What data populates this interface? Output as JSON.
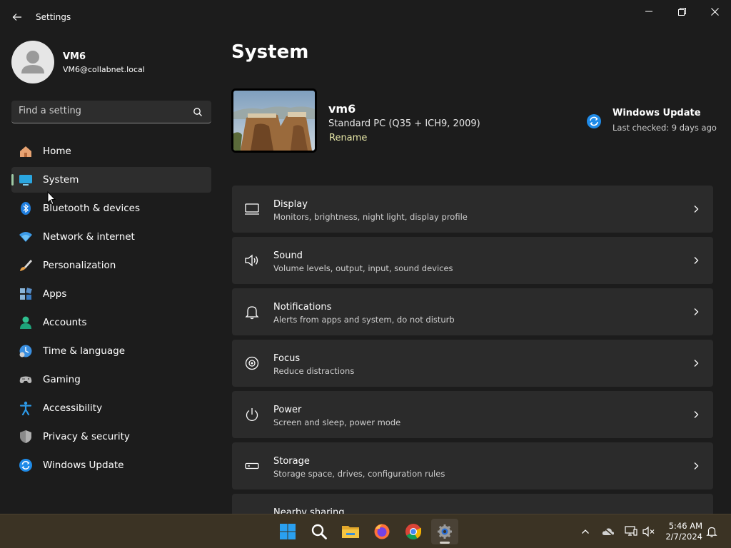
{
  "window": {
    "title": "Settings"
  },
  "profile": {
    "name": "VM6",
    "email": "VM6@collabnet.local"
  },
  "search": {
    "placeholder": "Find a setting"
  },
  "nav": {
    "items": [
      {
        "label": "Home",
        "icon": "home-icon"
      },
      {
        "label": "System",
        "icon": "system-icon",
        "active": true
      },
      {
        "label": "Bluetooth & devices",
        "icon": "bluetooth-icon"
      },
      {
        "label": "Network & internet",
        "icon": "wifi-icon"
      },
      {
        "label": "Personalization",
        "icon": "brush-icon"
      },
      {
        "label": "Apps",
        "icon": "apps-icon"
      },
      {
        "label": "Accounts",
        "icon": "accounts-icon"
      },
      {
        "label": "Time & language",
        "icon": "time-language-icon"
      },
      {
        "label": "Gaming",
        "icon": "gamepad-icon"
      },
      {
        "label": "Accessibility",
        "icon": "accessibility-icon"
      },
      {
        "label": "Privacy & security",
        "icon": "shield-icon"
      },
      {
        "label": "Windows Update",
        "icon": "windows-update-icon"
      }
    ]
  },
  "main": {
    "title": "System",
    "device": {
      "name": "vm6",
      "model": "Standard PC (Q35 + ICH9, 2009)",
      "rename": "Rename"
    },
    "update": {
      "title": "Windows Update",
      "subtitle": "Last checked: 9 days ago"
    },
    "cards": [
      {
        "title": "Display",
        "subtitle": "Monitors, brightness, night light, display profile",
        "icon": "display-icon"
      },
      {
        "title": "Sound",
        "subtitle": "Volume levels, output, input, sound devices",
        "icon": "speaker-icon"
      },
      {
        "title": "Notifications",
        "subtitle": "Alerts from apps and system, do not disturb",
        "icon": "bell-icon"
      },
      {
        "title": "Focus",
        "subtitle": "Reduce distractions",
        "icon": "focus-icon"
      },
      {
        "title": "Power",
        "subtitle": "Screen and sleep, power mode",
        "icon": "power-icon"
      },
      {
        "title": "Storage",
        "subtitle": "Storage space, drives, configuration rules",
        "icon": "storage-icon"
      },
      {
        "title": "Nearby sharing",
        "subtitle": "",
        "icon": "share-icon"
      }
    ]
  },
  "taskbar": {
    "apps": [
      "start-icon",
      "search-icon",
      "file-explorer-icon",
      "firefox-icon",
      "chrome-icon",
      "settings-icon"
    ],
    "clock": {
      "time": "5:46 AM",
      "date": "2/7/2024"
    }
  },
  "colors": {
    "background": "#1c1c1c",
    "card": "#2b2b2b",
    "accent": "#9ec9a4",
    "taskbar": "#3b3324"
  }
}
